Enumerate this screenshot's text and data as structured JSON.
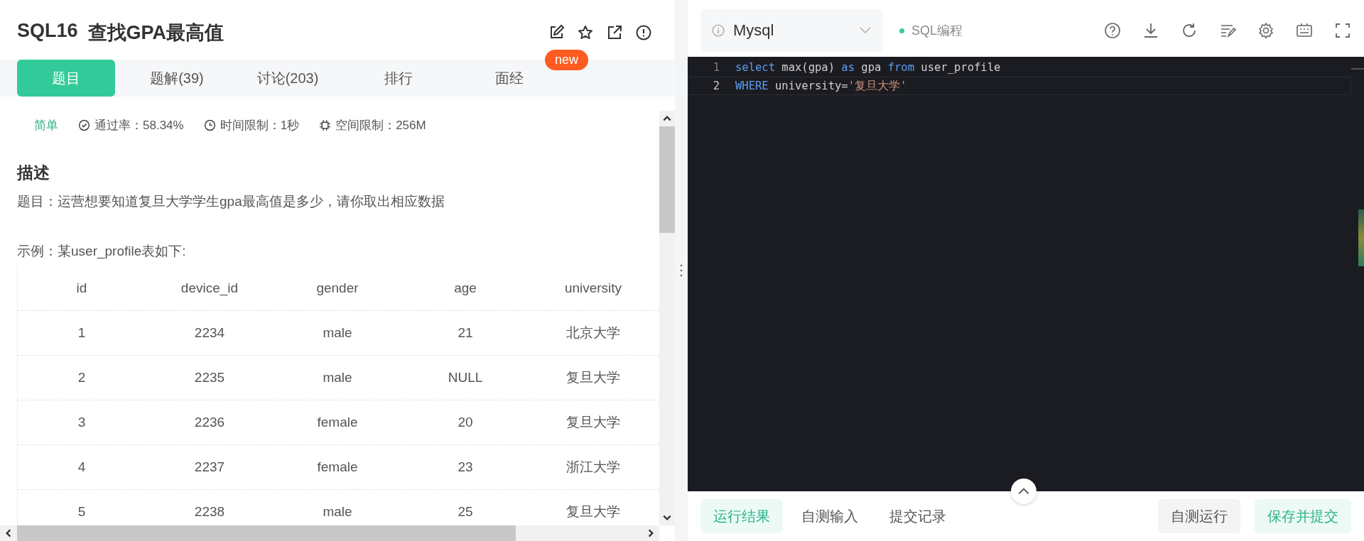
{
  "problem": {
    "code": "SQL16",
    "name": "查找GPA最高值",
    "badge": "new"
  },
  "tabs": [
    {
      "label": "题目",
      "selected": true
    },
    {
      "label": "题解(39)",
      "selected": false
    },
    {
      "label": "讨论(203)",
      "selected": false
    },
    {
      "label": "排行",
      "selected": false
    },
    {
      "label": "面经",
      "selected": false
    }
  ],
  "meta": {
    "difficulty": "简单",
    "pass_rate": "通过率：58.34%",
    "time_limit": "时间限制：1秒",
    "memory_limit": "空间限制：256M"
  },
  "description": {
    "heading": "描述",
    "text": "题目：运营想要知道复旦大学学生gpa最高值是多少，请你取出相应数据",
    "example": "示例：某user_profile表如下:"
  },
  "table": {
    "columns": [
      "id",
      "device_id",
      "gender",
      "age",
      "university"
    ],
    "rows": [
      [
        "1",
        "2234",
        "male",
        "21",
        "北京大学"
      ],
      [
        "2",
        "2235",
        "male",
        "NULL",
        "复旦大学"
      ],
      [
        "3",
        "2236",
        "female",
        "20",
        "复旦大学"
      ],
      [
        "4",
        "2237",
        "female",
        "23",
        "浙江大学"
      ],
      [
        "5",
        "2238",
        "male",
        "25",
        "复旦大学"
      ]
    ]
  },
  "editor": {
    "language": "Mysql",
    "mode": "SQL编程",
    "lines": [
      {
        "number": "1",
        "current": false,
        "tokens": [
          {
            "kind": "keyword",
            "text": "select"
          },
          {
            "kind": "plain",
            "text": " max(gpa) "
          },
          {
            "kind": "keyword",
            "text": "as"
          },
          {
            "kind": "plain",
            "text": " gpa "
          },
          {
            "kind": "keyword",
            "text": "from"
          },
          {
            "kind": "plain",
            "text": " user_profile"
          }
        ]
      },
      {
        "number": "2",
        "current": true,
        "tokens": [
          {
            "kind": "keyword",
            "text": "WHERE"
          },
          {
            "kind": "plain",
            "text": " university="
          },
          {
            "kind": "string",
            "text": "'复旦大学'"
          }
        ]
      }
    ]
  },
  "result_tabs": [
    {
      "label": "运行结果",
      "selected": true
    },
    {
      "label": "自测输入",
      "selected": false
    },
    {
      "label": "提交记录",
      "selected": false
    }
  ],
  "buttons": [
    {
      "label": "自测运行",
      "kind": "secondary"
    },
    {
      "label": "保存并提交",
      "kind": "primary"
    }
  ]
}
